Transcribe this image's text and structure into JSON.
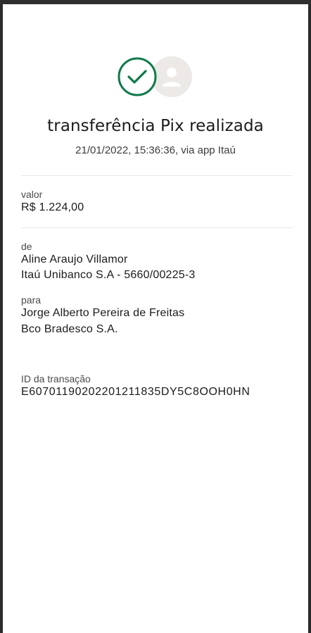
{
  "receipt": {
    "title": "transferência Pix realizada",
    "subtitle": "21/01/2022,  15:36:36, via app Itaú",
    "amount": {
      "label": "valor",
      "value": "R$ 1.224,00"
    },
    "from": {
      "label": "de",
      "name": "Aline Araujo Villamor",
      "bank": "Itaú Unibanco S.A - 5660/00225-3"
    },
    "to": {
      "label": "para",
      "name": "Jorge Alberto Pereira de Freitas",
      "bank": "Bco Bradesco S.A."
    },
    "transaction": {
      "label": "ID da transação",
      "id": "E60701190202201211835DY5C8OOH0HN"
    }
  },
  "colors": {
    "success": "#0f7a4a",
    "avatar_bg": "#ece9e6",
    "avatar_icon": "#ffffff"
  },
  "icons": {
    "status": "success-check-icon",
    "recipient": "user-avatar-icon"
  }
}
